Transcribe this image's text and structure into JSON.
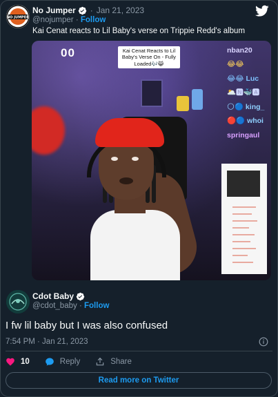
{
  "quoted": {
    "name": "No Jumper",
    "date_sep": "·",
    "date": "Jan 21, 2023",
    "handle": "@nojumper",
    "follow_sep": "·",
    "follow_label": "Follow",
    "text": "Kai Cenat reacts to Lil Baby's verse on Trippie Redd's album",
    "avatar_text": "NO JUMPER"
  },
  "video": {
    "timer": "00",
    "caption": "Kai Cenat Reacts to Lil Baby's Verse On - Fully Loaded🎶😹",
    "chat": [
      {
        "text": "nban20",
        "color": "#d9d4ff"
      },
      {
        "text": "😂😂",
        "color": "#ffd35a"
      },
      {
        "text": "😂😂 Luc",
        "color": "#7fc4ff"
      },
      {
        "text": "🌥️🅽🐳🅰",
        "color": "#cfd7ff"
      },
      {
        "text": "🌕🔵 king_",
        "color": "#8fd0ff"
      },
      {
        "text": "🔴🔵 whoi",
        "color": "#8fd0ff"
      },
      {
        "text": "springaul",
        "color": "#d8a0ff"
      }
    ]
  },
  "tweet": {
    "name": "Cdot Baby",
    "handle": "@cdot_baby",
    "follow_sep": "·",
    "follow_label": "Follow",
    "text": "I fw lil baby but I was also confused",
    "timestamp": "7:54 PM · Jan 21, 2023",
    "likes": "10",
    "reply_label": "Reply",
    "share_label": "Share",
    "read_more_label": "Read more on Twitter"
  },
  "colors": {
    "background": "#15202b",
    "accent": "#1d9bf0",
    "like": "#f91880",
    "muted": "#8b98a5"
  },
  "icons": [
    "verified-icon",
    "twitter-bird-icon",
    "info-icon",
    "heart-icon",
    "reply-icon",
    "share-icon"
  ]
}
